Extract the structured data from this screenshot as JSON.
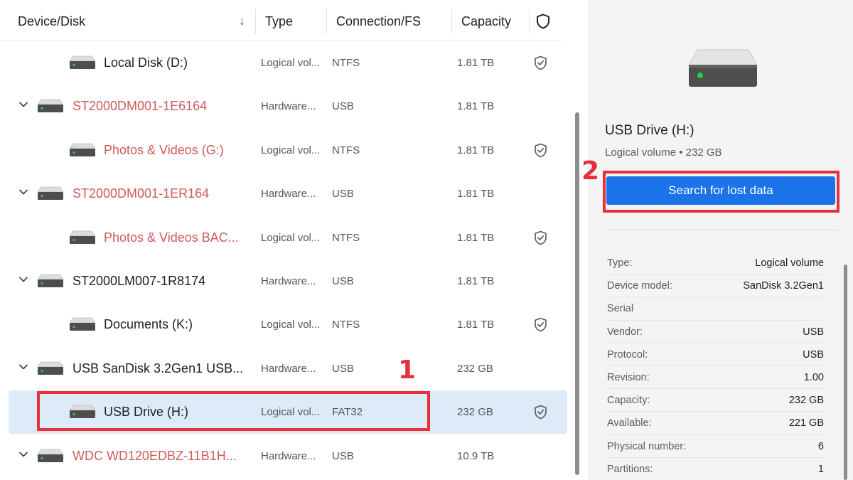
{
  "columns": {
    "device": "Device/Disk",
    "sort": "↓",
    "type": "Type",
    "connection": "Connection/FS",
    "capacity": "Capacity"
  },
  "rows": [
    {
      "name": "Local Disk (D:)",
      "type": "Logical vol...",
      "fs": "NTFS",
      "capacity": "1.81 TB",
      "level": "child",
      "red": false
    },
    {
      "name": "ST2000DM001-1E6164",
      "type": "Hardware...",
      "fs": "USB",
      "capacity": "1.81 TB",
      "level": "parent",
      "red": true
    },
    {
      "name": "Photos & Videos (G:)",
      "type": "Logical vol...",
      "fs": "NTFS",
      "capacity": "1.81 TB",
      "level": "child",
      "red": true
    },
    {
      "name": "ST2000DM001-1ER164",
      "type": "Hardware...",
      "fs": "USB",
      "capacity": "1.81 TB",
      "level": "parent",
      "red": true
    },
    {
      "name": "Photos & Videos BAC...",
      "type": "Logical vol...",
      "fs": "NTFS",
      "capacity": "1.81 TB",
      "level": "child",
      "red": true
    },
    {
      "name": "ST2000LM007-1R8174",
      "type": "Hardware...",
      "fs": "USB",
      "capacity": "1.81 TB",
      "level": "parent",
      "red": false
    },
    {
      "name": "Documents (K:)",
      "type": "Logical vol...",
      "fs": "NTFS",
      "capacity": "1.81 TB",
      "level": "child",
      "red": false
    },
    {
      "name": "USB  SanDisk 3.2Gen1 USB...",
      "type": "Hardware...",
      "fs": "USB",
      "capacity": "232 GB",
      "level": "parent",
      "red": false
    },
    {
      "name": "USB Drive (H:)",
      "type": "Logical vol...",
      "fs": "FAT32",
      "capacity": "232 GB",
      "level": "child",
      "red": false,
      "selected": true
    },
    {
      "name": "WDC WD120EDBZ-11B1H...",
      "type": "Hardware...",
      "fs": "USB",
      "capacity": "10.9 TB",
      "level": "parent",
      "red": true
    }
  ],
  "annotations": {
    "step1": "1",
    "step2": "2"
  },
  "details": {
    "title": "USB Drive (H:)",
    "subtitle": "Logical volume • 232 GB",
    "search_button": "Search for lost data",
    "properties": [
      {
        "key": "Type:",
        "value": "Logical volume"
      },
      {
        "key": "Device model:",
        "value": "SanDisk 3.2Gen1"
      },
      {
        "key": "Serial",
        "value": ""
      },
      {
        "key": "Vendor:",
        "value": "USB"
      },
      {
        "key": "Protocol:",
        "value": "USB"
      },
      {
        "key": "Revision:",
        "value": "1.00"
      },
      {
        "key": "Capacity:",
        "value": "232 GB"
      },
      {
        "key": "Available:",
        "value": "221 GB"
      },
      {
        "key": "Physical number:",
        "value": "6"
      },
      {
        "key": "Partitions:",
        "value": "1"
      }
    ]
  },
  "icons": {
    "disk": "disk-drive-icon",
    "expand": "chevron-down-icon",
    "protection": "shield-check-icon",
    "header_protection": "shield-icon"
  },
  "colors": {
    "accent": "#1a73e8",
    "selection": "#ddebf9",
    "warning_text": "#d15a5a",
    "annotation": "#e8303a",
    "led": "#2ecc40"
  }
}
